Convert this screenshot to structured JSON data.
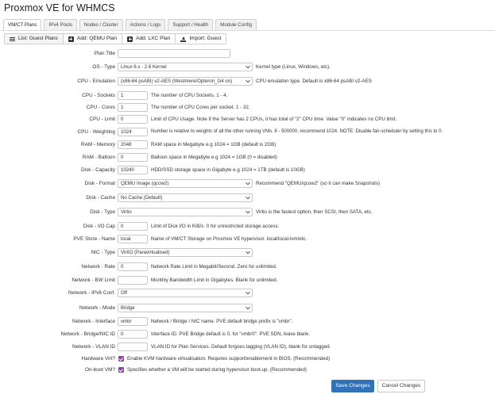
{
  "app_title": "Proxmox VE for WHMCS",
  "tabs": [
    {
      "label": "VM/CT Plans",
      "active": true
    },
    {
      "label": "IPv4 Pools"
    },
    {
      "label": "Nodes / Cluster"
    },
    {
      "label": "Actions / Logs"
    },
    {
      "label": "Support / Health"
    },
    {
      "label": "Module Config"
    }
  ],
  "subtabs": [
    {
      "label": "List: Guest Plans",
      "icon": "list-icon",
      "active": true
    },
    {
      "label": "Add: QEMU Plan",
      "icon": "plus-square-icon"
    },
    {
      "label": "Add: LXC Plan",
      "icon": "plus-square-icon"
    },
    {
      "label": "Import: Guest",
      "icon": "upload-icon"
    }
  ],
  "form": {
    "plan_title": {
      "label": "Plan Title",
      "value": ""
    },
    "os_type": {
      "label": "OS - Type",
      "value": "Linux 6.x - 2.6 Kernel",
      "help": "Kernel type (Linux, Windows, etc)."
    },
    "cpu_emulation": {
      "label": "CPU - Emulation",
      "value": "(x86-64 psABI) v2-AES (Westmere/Opteron_G4 on)",
      "help": "CPU emulation type. Default is x86-64 psABI v2-AES"
    },
    "cpu_sockets": {
      "label": "CPU - Sockets",
      "value": "1",
      "help": "The number of CPU Sockets. 1 - 4."
    },
    "cpu_cores": {
      "label": "CPU - Cores",
      "value": "1",
      "help": "The number of CPU Cores per socket. 1 - 32."
    },
    "cpu_limit": {
      "label": "CPU - Limit",
      "value": "0",
      "help": "Limit of CPU Usage. Note if the Server has 2 CPUs, it has total of \"2\" CPU time. Value \"0\" indicates no CPU limit."
    },
    "cpu_weighting": {
      "label": "CPU - Weighting",
      "value": "1024",
      "help": "Number is relative to weights of all the other running VMs. 8 - 500000, recommend 1024. NOTE: Disable fair-scheduler by setting this to 0."
    },
    "ram_memory": {
      "label": "RAM - Memory",
      "value": "2048",
      "help": "RAM space in Megabyte e.g 1024 = 1GB (default is 2GB)"
    },
    "ram_balloon": {
      "label": "RAM - Balloon",
      "value": "0",
      "help": "Balloon space in Megabyte e.g 1024 = 1GB (0 = disabled)"
    },
    "disk_capacity": {
      "label": "Disk - Capacity",
      "value": "10240",
      "help": "HDD/SSD storage space in Gigabyte e.g 1024 = 1TB (default is 10GB)"
    },
    "disk_format": {
      "label": "Disk - Format",
      "value": "QEMU Image (qcow2)",
      "help": "Recommend \"QEMU/qcow2\" (so it can make Snapshots)"
    },
    "disk_cache": {
      "label": "Disk - Cache",
      "value": "No Cache (Default)"
    },
    "disk_type": {
      "label": "Disk - Type",
      "value": "Virtio",
      "help": "Virtio is the fastest option, then SCSI, then SATA, etc."
    },
    "disk_io_cap": {
      "label": "Disk - I/O Cap",
      "value": "0",
      "help": "Limit of Disk I/O in KiB/s. 0 for unrestricted storage access."
    },
    "pve_store": {
      "label": "PVE Store - Name",
      "value": "local",
      "help": "Name of VM/CT Storage on Proxmox VE hypervisor. local/local-lvm/etc."
    },
    "nic_type": {
      "label": "NIC - Type",
      "value": "VirtIO (Paravirtualised)"
    },
    "network_rate": {
      "label": "Network - Rate",
      "value": "0",
      "help": "Network Rate Limit in Megabit/Second. Zero for unlimited."
    },
    "network_bw_limit": {
      "label": "Network - BW Limit",
      "value": "",
      "help": "Monthly Bandwidth Limit in Gigabytes. Blank for unlimited."
    },
    "network_ipv6": {
      "label": "Network - IPv6 Conf.",
      "value": "Off"
    },
    "network_mode": {
      "label": "Network - Mode",
      "value": "Bridge"
    },
    "network_interface": {
      "label": "Network - Interface",
      "value": "vmbr",
      "help": "Network / Bridge / NIC name. PVE default bridge prefix is \"vmbr\"."
    },
    "network_bridge_nic_id": {
      "label": "Network - Bridge/NIC ID",
      "value": "0",
      "help": "Interface ID. PVE Bridge default is 0, for \"vmbr0\". PVE SDN, leave blank."
    },
    "network_vlan_id": {
      "label": "Network - VLAN ID",
      "value": "",
      "help": "VLAN ID for Plan Services. Default forgoes tagging (VLAN ID), blank for untagged."
    },
    "hardware_virt": {
      "label": "Hardware Virt?",
      "checked": true,
      "help": "Enable KVM hardware virtualisation. Requires support/enablement in BIOS. (Recommended)"
    },
    "onboot_vm": {
      "label": "On-boot VM?",
      "checked": true,
      "help": "Specifies whether a VM will be started during hypervisor boot-up. (Recommended)"
    }
  },
  "buttons": {
    "save": "Save Changes",
    "cancel": "Cancel Changes"
  },
  "colors": {
    "primary": "#2f72b8",
    "checkbox": "#8e44ad"
  }
}
